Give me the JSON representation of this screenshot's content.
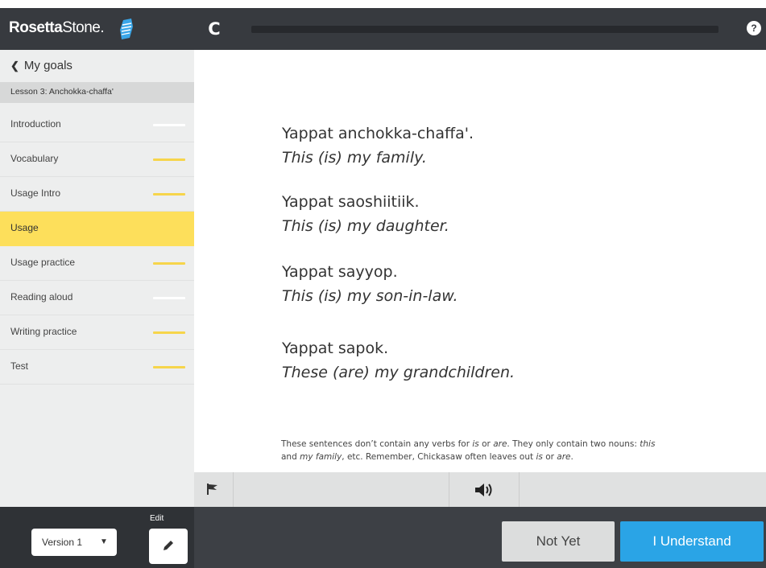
{
  "header": {
    "logo_primary": "Rosetta",
    "logo_secondary": "Stone.",
    "refresh_glyph": "C",
    "help_glyph": "?"
  },
  "sidebar": {
    "back_label": "My goals",
    "lesson_title": "Lesson 3: Anchokka-chaffa'",
    "items": [
      {
        "label": "Introduction",
        "status": "done"
      },
      {
        "label": "Vocabulary",
        "status": "pending"
      },
      {
        "label": "Usage Intro",
        "status": "pending"
      },
      {
        "label": "Usage",
        "status": "active"
      },
      {
        "label": "Usage practice",
        "status": "pending"
      },
      {
        "label": "Reading aloud",
        "status": "done"
      },
      {
        "label": "Writing practice",
        "status": "pending"
      },
      {
        "label": "Test",
        "status": "pending"
      }
    ]
  },
  "content": {
    "phrases": [
      {
        "native": "Yappat anchokka-chaffa'.",
        "translation": "This (is) my family."
      },
      {
        "native": "Yappat saoshiitiik.",
        "translation": "This (is) my daughter."
      },
      {
        "native": "Yappat sayyop.",
        "translation": "This (is) my son-in-law."
      },
      {
        "native": "Yappat sapok.",
        "translation": "These (are) my grandchildren."
      }
    ],
    "note": {
      "p1": "These sentences don’t contain any verbs for ",
      "e1": "is",
      "p2": " or ",
      "e2": "are",
      "p3": ". They only contain two nouns: ",
      "e3": "this",
      "p4": " and ",
      "e4": "my family",
      "p5": ", etc. Remember, Chickasaw often leaves out ",
      "e5": "is",
      "p6": " or ",
      "e6": "are",
      "p7": "."
    }
  },
  "controls": {
    "flag_icon": "flag-icon",
    "audio_icon": "speaker-icon"
  },
  "footer": {
    "version_value": "Version 1",
    "version_arrow": "▼",
    "edit_label": "Edit",
    "not_yet_label": "Not Yet",
    "understand_label": "I Understand"
  },
  "colors": {
    "topbar": "#373a3f",
    "active_item": "#fddf5b",
    "pending_bar": "#f6d54b",
    "primary_button": "#2aa4e6",
    "secondary_button": "#dcdddd"
  }
}
